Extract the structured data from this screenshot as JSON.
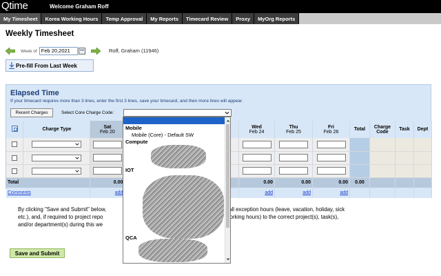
{
  "app": {
    "logo": "Qtime",
    "welcome": "Welcome Graham Roff"
  },
  "nav": {
    "items": [
      {
        "label": "My Timesheet"
      },
      {
        "label": "Korea Working Hours"
      },
      {
        "label": "Temp Approval"
      },
      {
        "label": "My Reports"
      },
      {
        "label": "Timecard Review"
      },
      {
        "label": "Proxy"
      },
      {
        "label": "MyOrg Reports"
      }
    ]
  },
  "page": {
    "title": "Weekly Timesheet",
    "week_label": "Week of",
    "week_value": "Feb 20,2021",
    "employee": "Roff, Graham (11946)",
    "prefill_label": "Pre-fill From Last Week"
  },
  "elapsed": {
    "title": "Elapsed Time",
    "note": "If your timecard requires more than 3 lines, enter the first 3 lines, save your timecard, and then more lines will appear.",
    "recent_charges": "Recent Charges",
    "core_label": "Select Core Charge Code:",
    "core_value": ""
  },
  "grid": {
    "headers": {
      "charge_type": "Charge Type",
      "sat": "Sat",
      "sat_date": "Feb 20",
      "wed": "Wed",
      "wed_date": "Feb 24",
      "thu": "Thu",
      "thu_date": "Feb 25",
      "fri": "Fri",
      "fri_date": "Feb 26",
      "total": "Total",
      "charge_code_1": "Charge",
      "charge_code_2": "Code",
      "task": "Task",
      "dept": "Dept"
    },
    "total_row": {
      "label": "Total",
      "sat": "0.00",
      "wed": "0.00",
      "thu": "0.00",
      "fri": "0.00",
      "total": "0.00"
    },
    "comments_row": {
      "label": "Comments",
      "add": "add"
    }
  },
  "dropdown": {
    "items": [
      {
        "label": "Mobile",
        "group": true
      },
      {
        "label": "Mobile (Core) - Default SW",
        "group": false
      },
      {
        "label": "Compute",
        "group": true
      },
      {
        "label": "IOT",
        "group": true
      },
      {
        "label": "QCA",
        "group": true
      }
    ]
  },
  "disclaimer": {
    "line1a": "By clicking \"Save and Submit\" below,",
    "line1b": "recorded all exception hours (leave, vacation, holiday, sick",
    "line2a": "etc.), and, if required to project repo",
    "line2b": "standard working hours) to the correct project(s), task(s),",
    "line3": "and/or department(s) during this we"
  },
  "actions": {
    "submit": "Save and Submit"
  }
}
